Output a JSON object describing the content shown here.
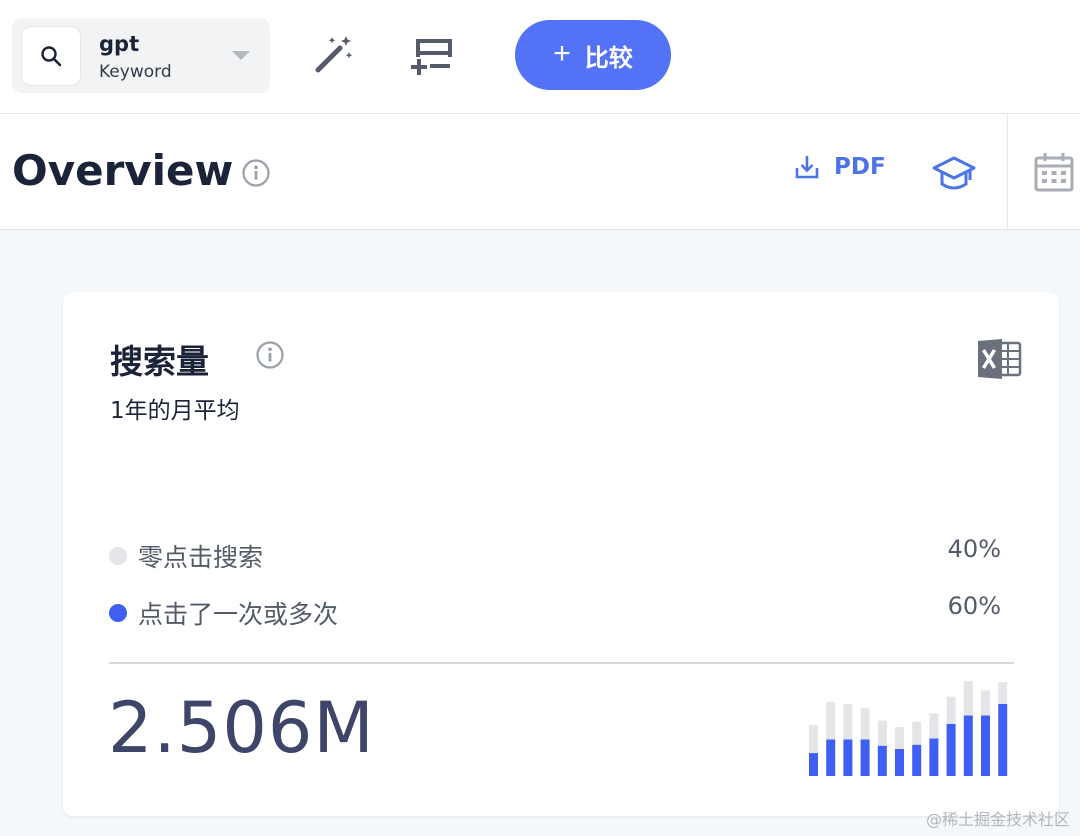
{
  "search": {
    "keyword": "gpt",
    "type": "Keyword"
  },
  "toolbar": {
    "compare_label": "比较"
  },
  "header": {
    "title": "Overview",
    "pdf_label": "PDF"
  },
  "card": {
    "title": "搜索量",
    "subtitle": "1年的月平均",
    "legend": [
      {
        "label": "零点击搜索",
        "pct": "40%",
        "color": "#e4e5e8"
      },
      {
        "label": "点击了一次或多次",
        "pct": "60%",
        "color": "#3f5ef2"
      }
    ],
    "total": "2.506M"
  },
  "chart_data": {
    "type": "bar",
    "stacked": true,
    "series": [
      {
        "values": [
          22,
          35,
          35,
          35,
          29,
          26,
          30,
          36,
          50,
          58,
          58,
          69
        ],
        "color": "#3f5ef2"
      },
      {
        "values": [
          27,
          36,
          34,
          30,
          24,
          21,
          22,
          24,
          26,
          33,
          24,
          21
        ],
        "color": "#e4e5e8"
      }
    ],
    "ylim": [
      0,
      92
    ]
  },
  "footer": {
    "watermark": "@稀土掘金技术社区"
  },
  "colors": {
    "accent": "#5472f5",
    "link": "#4d74e6",
    "background": "#f4f8fb"
  },
  "icons": [
    "search-icon",
    "magic-wand-icon",
    "add-list-icon",
    "info-icon",
    "download-icon",
    "graduation-cap-icon",
    "calendar-icon",
    "excel-icon"
  ]
}
